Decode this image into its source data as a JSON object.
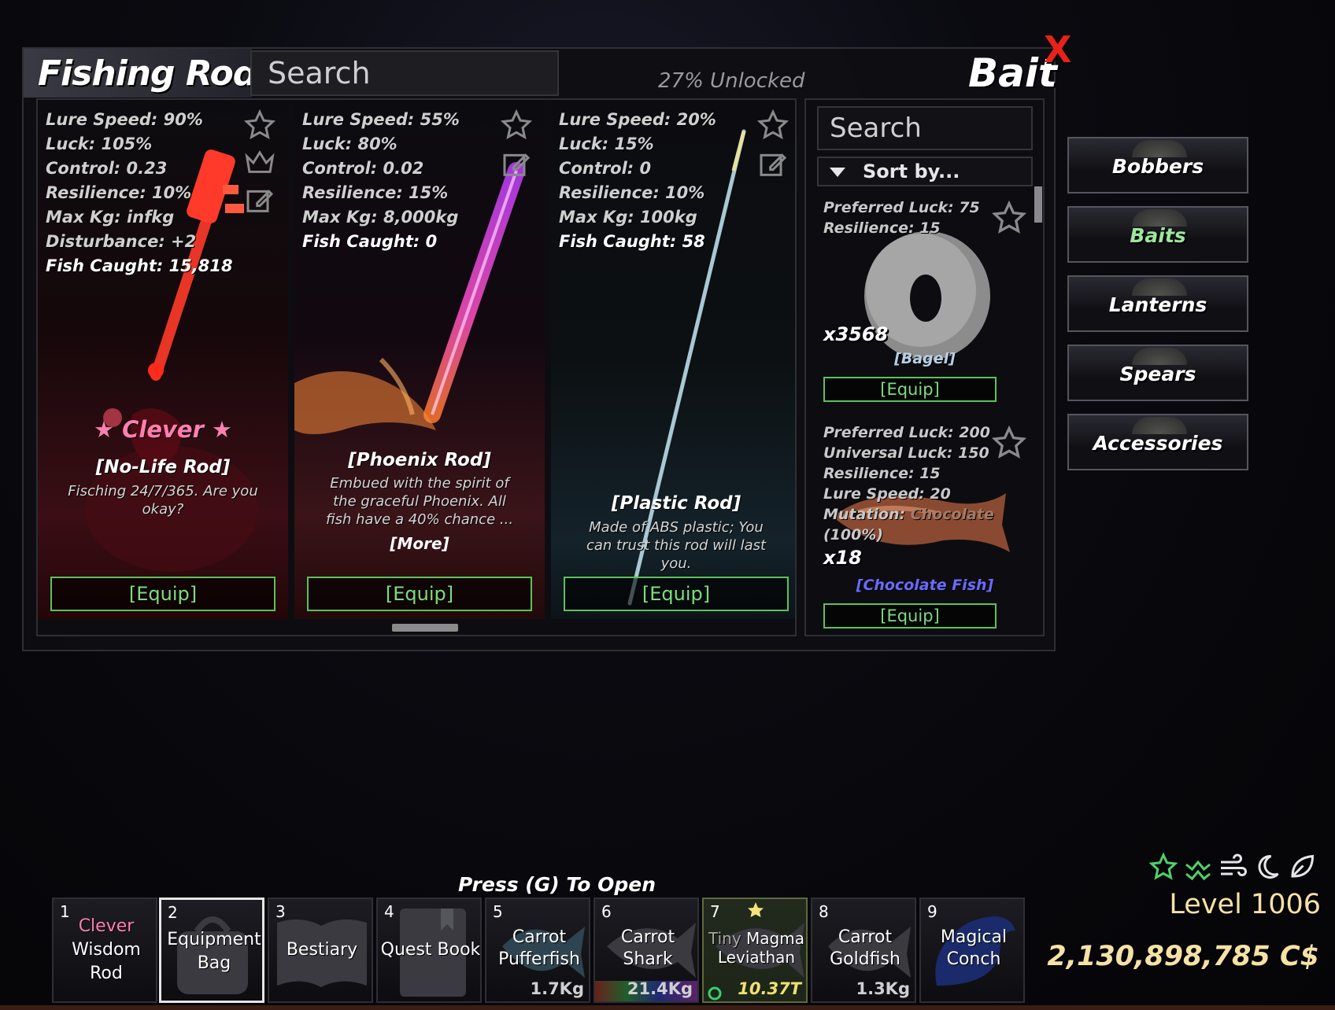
{
  "window": {
    "title": "Fishing Rods",
    "search_placeholder": "Search",
    "unlocked": "27% Unlocked",
    "bait_title": "Bait",
    "close_label": "X"
  },
  "rods": [
    {
      "stats": [
        "Lure Speed: 90%",
        "Luck: 105%",
        "Control: 0.23",
        "Resilience: 10%",
        "Max Kg: infkg",
        "Disturbance: +2"
      ],
      "caught": "Fish Caught: 15,818",
      "rarity": "★ Clever ★",
      "name": "[No-Life Rod]",
      "desc": "Fisching 24/7/365. Are you okay?",
      "equip": "[Equip]"
    },
    {
      "stats": [
        "Lure Speed: 55%",
        "Luck: 80%",
        "Control: 0.02",
        "Resilience: 15%",
        "Max Kg: 8,000kg"
      ],
      "caught": "Fish Caught: 0",
      "name": "[Phoenix Rod]",
      "desc": "Embued with the spirit of the graceful Phoenix. All fish have a 40% chance ...",
      "more": "[More]",
      "equip": "[Equip]"
    },
    {
      "stats": [
        "Lure Speed: 20%",
        "Luck: 15%",
        "Control: 0",
        "Resilience: 10%",
        "Max Kg: 100kg"
      ],
      "caught": "Fish Caught: 58",
      "name": "[Plastic Rod]",
      "desc": "Made of ABS plastic; You can trust this rod will last you.",
      "equip": "[Equip]"
    }
  ],
  "bait": {
    "search_placeholder": "Search",
    "sort_label": "Sort by...",
    "items": [
      {
        "stats": [
          "Preferred Luck: 75",
          "Resilience: 15"
        ],
        "count": "x3568",
        "name": "[Bagel]",
        "equip": "[Equip]"
      },
      {
        "stats": [
          "Preferred Luck: 200",
          "Universal Luck: 150",
          "Resilience: 15",
          "Lure Speed: 20"
        ],
        "mutation_label": "Mutation:",
        "mutation_value": "Chocolate",
        "mutation_pct": "(100%)",
        "count": "x18",
        "name": "[Chocolate Fish]",
        "equip": "[Equip]"
      }
    ]
  },
  "categories": [
    "Bobbers",
    "Baits",
    "Lanterns",
    "Spears",
    "Accessories"
  ],
  "hotbar": {
    "hint": "Press (G) To Open",
    "slots": [
      {
        "num": "1",
        "line1": "Clever",
        "line2": "Wisdom",
        "line3": "Rod"
      },
      {
        "num": "2",
        "line1": "Equipment",
        "line2": "Bag"
      },
      {
        "num": "3",
        "line1": "Bestiary"
      },
      {
        "num": "4",
        "line1": "Quest Book"
      },
      {
        "num": "5",
        "line1": "Carrot",
        "line2": "Pufferfish",
        "weight": "1.7Kg"
      },
      {
        "num": "6",
        "line1": "Carrot",
        "line2": "Shark",
        "weight": "21.4Kg"
      },
      {
        "num": "7",
        "line1a": "Tiny",
        "line1b": "Magma",
        "line2": "Leviathan",
        "weight": "10.37T"
      },
      {
        "num": "8",
        "line1": "Carrot",
        "line2": "Goldfish",
        "weight": "1.3Kg"
      },
      {
        "num": "9",
        "line1": "Magical",
        "line2": "Conch"
      }
    ]
  },
  "player": {
    "level": "Level 1006",
    "money": "2,130,898,785 C$"
  },
  "colors": {
    "equip_green": "#5bc25b",
    "close_red": "#e8221a",
    "rarity_pink": "#ff7fb0",
    "gold_text": "#f6e1a6",
    "active_category": "#9de79d"
  },
  "icons": [
    "star-icon",
    "crown-icon",
    "edit-icon",
    "sort-triangle-icon",
    "weather-star-icon",
    "wind-wave-icon",
    "wind-icon",
    "moon-icon",
    "leaf-icon"
  ]
}
